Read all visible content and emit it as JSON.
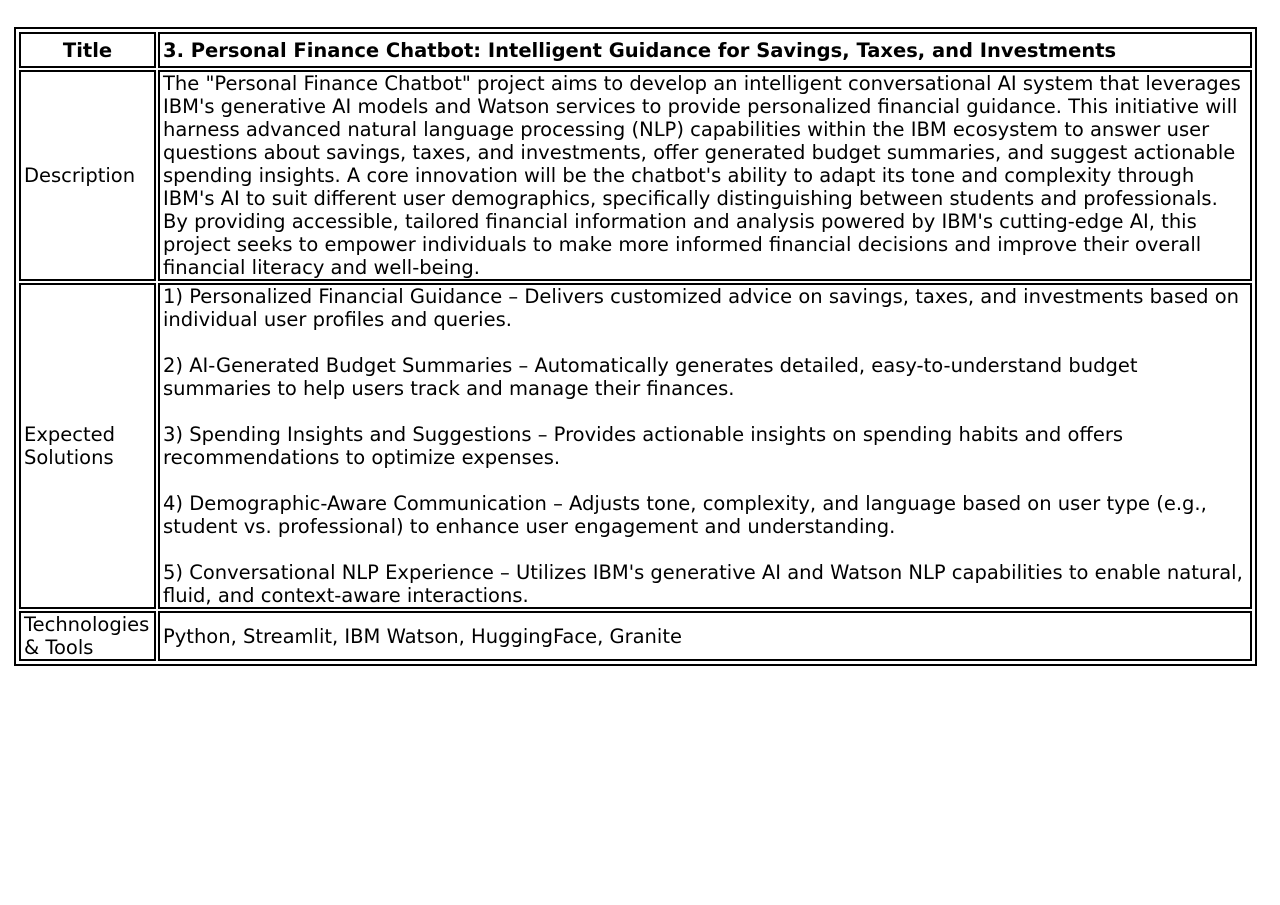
{
  "table": {
    "title": {
      "label": "Title",
      "value": "3. Personal Finance Chatbot: Intelligent Guidance for Savings, Taxes, and Investments"
    },
    "description": {
      "label": "Description",
      "value": "The \"Personal Finance Chatbot\" project aims to develop an intelligent conversational AI system that leverages IBM's generative AI models and Watson services to provide personalized financial guidance. This initiative will harness advanced natural language processing (NLP) capabilities within the IBM ecosystem to answer user questions about savings, taxes, and investments, offer generated budget summaries, and suggest actionable spending insights. A core innovation will be the chatbot's ability to adapt its tone and complexity through IBM's AI to suit different user demographics, specifically distinguishing between students and professionals. By providing accessible, tailored financial information and analysis powered by IBM's cutting-edge AI, this project seeks to empower individuals to make more informed financial decisions and improve their overall financial literacy and well-being."
    },
    "expected_solutions": {
      "label": "Expected Solutions",
      "items": [
        "1) Personalized Financial Guidance – Delivers customized advice on savings, taxes, and investments based on individual user profiles and queries.",
        "2) AI-Generated Budget Summaries – Automatically generates detailed, easy-to-understand budget summaries to help users track and manage their finances.",
        "3) Spending Insights and Suggestions – Provides actionable insights on spending habits and offers recommendations to optimize expenses.",
        "4) Demographic-Aware Communication – Adjusts tone, complexity, and language based on user type (e.g., student vs. professional) to enhance user engagement and understanding.",
        "5) Conversational NLP Experience – Utilizes IBM's generative AI and Watson NLP capabilities to enable natural, fluid, and context-aware interactions."
      ]
    },
    "technologies": {
      "label": "Technologies & Tools",
      "value": "Python, Streamlit, IBM Watson, HuggingFace, Granite"
    }
  }
}
